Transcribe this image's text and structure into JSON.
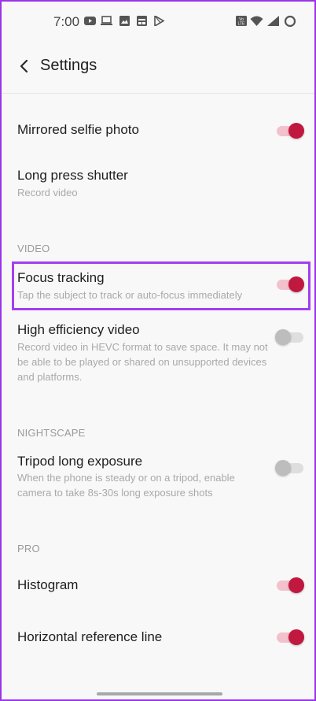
{
  "status_bar": {
    "time": "7:00",
    "left_icons": [
      "youtube-icon",
      "laptop-icon",
      "image-icon",
      "calendar-icon",
      "play-store-icon"
    ],
    "right_icons": [
      "volte-icon",
      "wifi-icon",
      "signal-icon",
      "battery-icon"
    ]
  },
  "header": {
    "title": "Settings",
    "back_icon": "chevron-left-icon"
  },
  "colors": {
    "accent": "#c0183f",
    "accent_track": "#f2c1cc",
    "highlight": "#a43ff0"
  },
  "settings": [
    {
      "title": "Mirrored selfie photo",
      "subtitle": "",
      "toggle": true
    },
    {
      "title": "Long press shutter",
      "subtitle": "Record video",
      "toggle": null
    },
    {
      "section": "VIDEO"
    },
    {
      "title": "Focus tracking",
      "subtitle": "Tap the subject to track or auto-focus immediately",
      "toggle": true,
      "highlighted": true
    },
    {
      "title": "High efficiency video",
      "subtitle": "Record video in HEVC format to save space. It may not be able to be played or shared on unsupported devices and platforms.",
      "toggle": false
    },
    {
      "section": "NIGHTSCAPE"
    },
    {
      "title": "Tripod long exposure",
      "subtitle": "When the phone is steady or on a tripod, enable camera to take 8s-30s long exposure shots",
      "toggle": false
    },
    {
      "section": "PRO"
    },
    {
      "title": "Histogram",
      "subtitle": "",
      "toggle": true
    },
    {
      "title": "Horizontal reference line",
      "subtitle": "",
      "toggle": true
    }
  ]
}
